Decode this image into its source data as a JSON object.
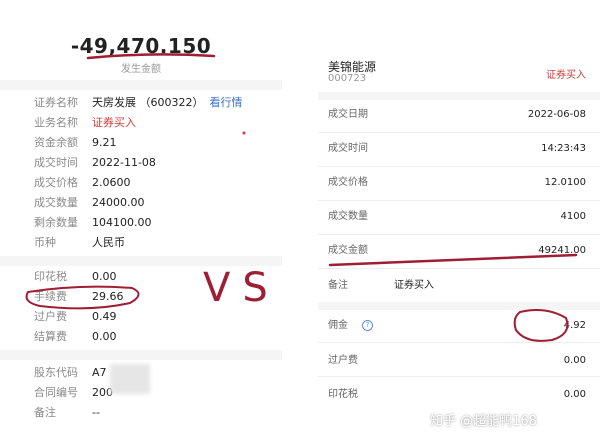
{
  "left": {
    "amount": "-49,470.150",
    "amount_label": "发生金额",
    "details": [
      {
        "key": "证券名称",
        "value": "天房发展  （600322）",
        "link": "看行情"
      },
      {
        "key": "业务名称",
        "value": "证券买入",
        "red": true
      },
      {
        "key": "资金余额",
        "value": "9.21"
      },
      {
        "key": "成交时间",
        "value": "2022-11-08"
      },
      {
        "key": "成交价格",
        "value": "2.0600"
      },
      {
        "key": "成交数量",
        "value": "24000.00"
      },
      {
        "key": "剩余数量",
        "value": "104100.00"
      },
      {
        "key": "币种",
        "value": "人民币"
      }
    ],
    "fees": [
      {
        "key": "印花税",
        "value": "0.00"
      },
      {
        "key": "手续费",
        "value": "29.66"
      },
      {
        "key": "过户费",
        "value": "0.49"
      },
      {
        "key": "结算费",
        "value": "0.00"
      }
    ],
    "accounts": [
      {
        "key": "股东代码",
        "value": "A7"
      },
      {
        "key": "合同编号",
        "value": "200"
      },
      {
        "key": "备注",
        "value": "--"
      }
    ]
  },
  "vs_text": "VS",
  "right": {
    "stock_name": "美锦能源",
    "stock_code": "000723",
    "trade_type": "证券买入",
    "rows": [
      {
        "key": "成交日期",
        "value": "2022-06-08"
      },
      {
        "key": "成交时间",
        "value": "14:23:43"
      },
      {
        "key": "成交价格",
        "value": "12.0100"
      },
      {
        "key": "成交数量",
        "value": "4100"
      },
      {
        "key": "成交金额",
        "value": "49241.00"
      }
    ],
    "remark_key": "备注",
    "remark_value": "证券买入",
    "commission_key": "佣金",
    "commission_help": "?",
    "commission_value": "4.92",
    "transfer_key": "过户费",
    "transfer_value": "0.00",
    "stamp_key": "印花税",
    "stamp_value": "0.00"
  },
  "watermark": "知乎 @超能鸭168",
  "colors": {
    "accent_red": "#d13b3b",
    "annotation": "#9e1e34",
    "link_blue": "#3a6fc7"
  }
}
